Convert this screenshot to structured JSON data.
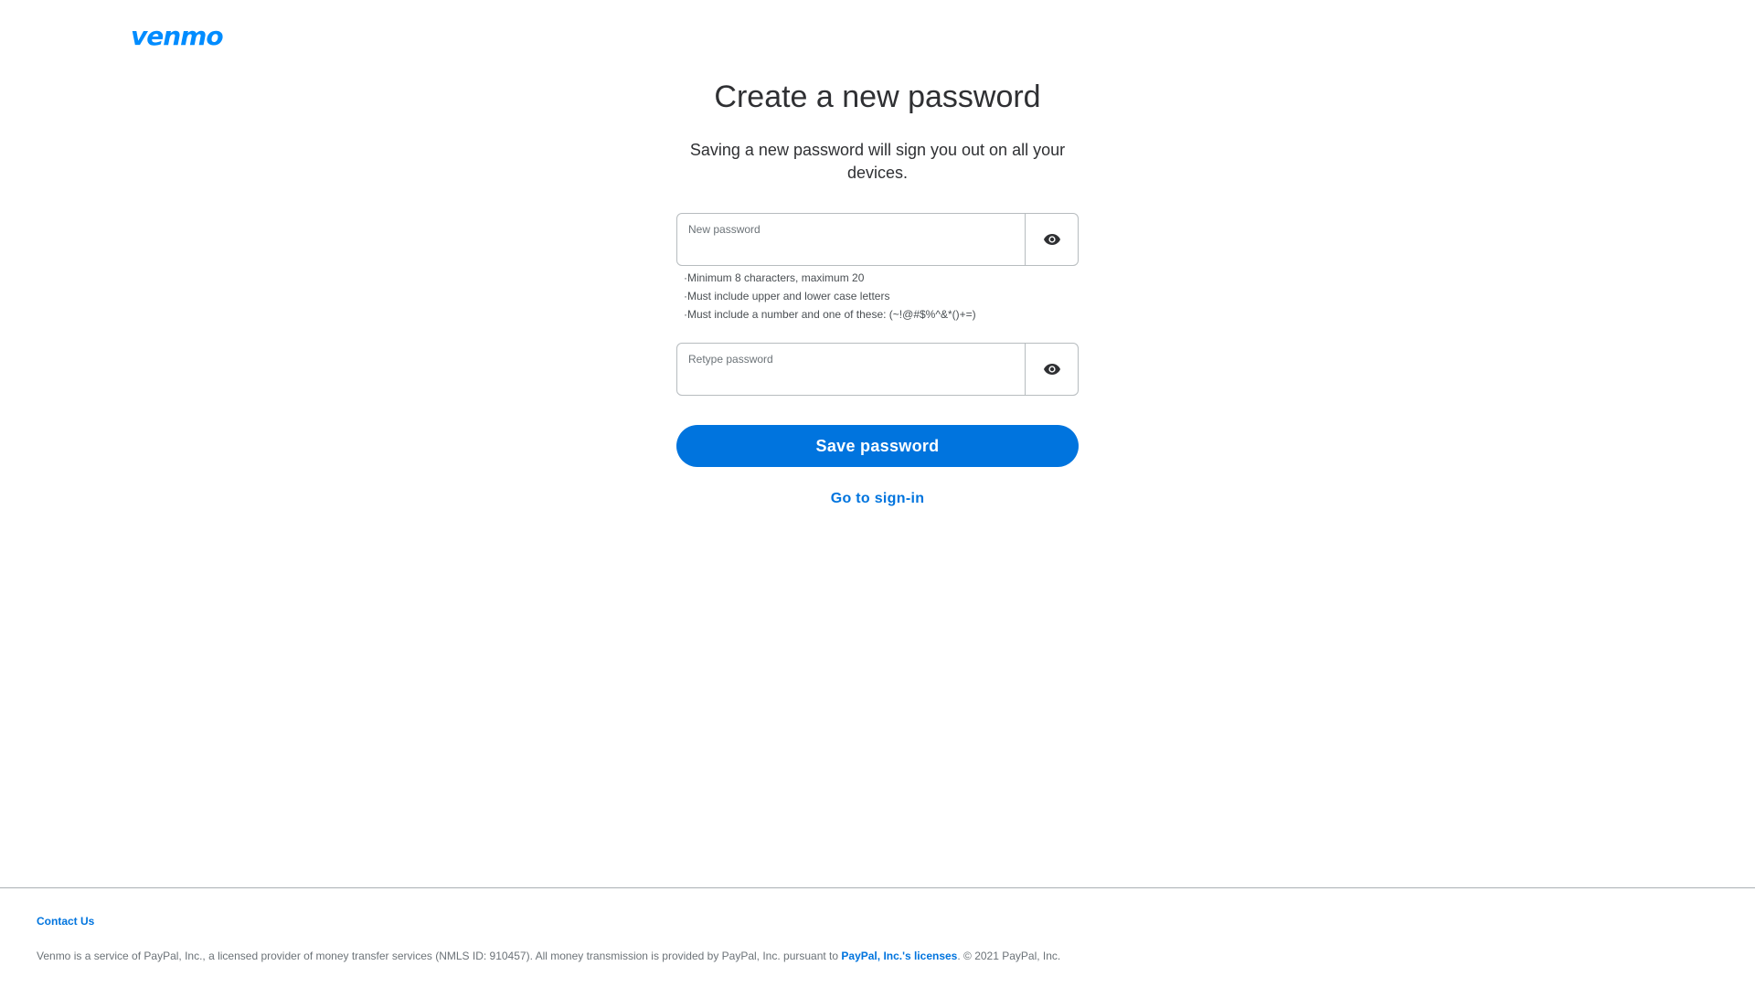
{
  "brand": {
    "logo_text": "venmo",
    "accent_color": "#0074de",
    "logo_color": "#008cff"
  },
  "page": {
    "title": "Create a new password",
    "subtitle": "Saving a new password will sign you out on all your devices."
  },
  "form": {
    "new_password": {
      "label": "New password",
      "value": "",
      "toggle_icon": "eye-icon"
    },
    "requirements": [
      "Minimum 8 characters, maximum 20",
      "Must include upper and lower case letters",
      "Must include a number and one of these: (~!@#$%^&*()+=)"
    ],
    "retype_password": {
      "label": "Retype password",
      "value": "",
      "toggle_icon": "eye-icon"
    },
    "save_label": "Save password",
    "signin_label": "Go to sign-in"
  },
  "footer": {
    "contact_label": "Contact Us",
    "legal_prefix": "Venmo is a service of PayPal, Inc., a licensed provider of money transfer services (NMLS ID: 910457). All money transmission is provided by PayPal, Inc. pursuant to ",
    "legal_link": "PayPal, Inc.'s licenses",
    "legal_suffix": ". © 2021 PayPal, Inc."
  }
}
